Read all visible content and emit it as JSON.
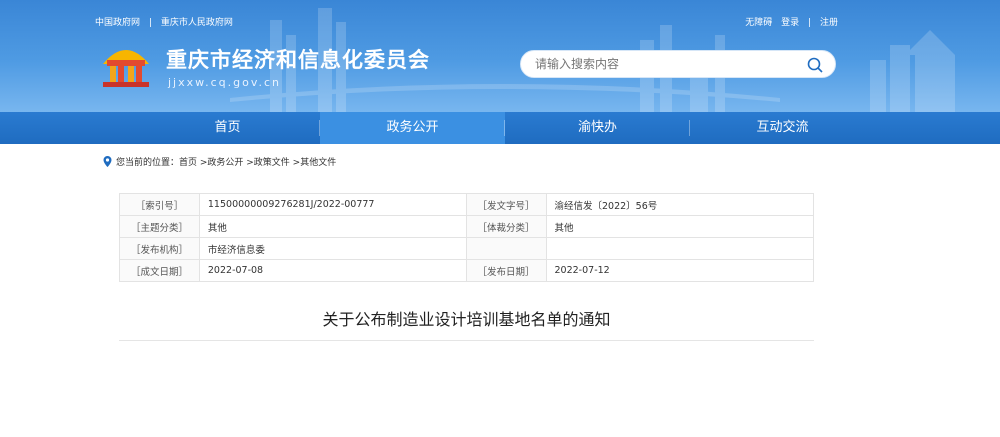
{
  "header": {
    "top_links": [
      "中国政府网",
      "|",
      "重庆市人民政府网"
    ],
    "right_links": [
      "无障碍",
      "登录",
      "|",
      "注册"
    ],
    "site_title": "重庆市经济和信息化委员会",
    "site_url": "jjxxw.cq.gov.cn",
    "search_placeholder": "请输入搜索内容"
  },
  "nav": {
    "items": [
      "首页",
      "政务公开",
      "渝快办",
      "互动交流"
    ],
    "active_index": 1
  },
  "breadcrumb": "您当前的位置：首页 >政务公开 >政策文件 >其他文件",
  "info": {
    "rows": [
      {
        "k1": "［索引号］",
        "v1": "11500000009276281J/2022-00777",
        "k2": "［发文字号］",
        "v2": "渝经信发〔2022〕56号"
      },
      {
        "k1": "［主题分类］",
        "v1": "其他",
        "k2": "［体裁分类］",
        "v2": "其他"
      },
      {
        "k1": "［发布机构］",
        "v1": "市经济信息委",
        "k2": "",
        "v2": ""
      },
      {
        "k1": "［成文日期］",
        "v1": "2022-07-08",
        "k2": "［发布日期］",
        "v2": "2022-07-12"
      }
    ]
  },
  "doc_title": "关于公布制造业设计培训基地名单的通知",
  "colors": {
    "banner": "#3a86d6",
    "nav": "#1f6cc0",
    "nav_active": "#3b90e2"
  }
}
